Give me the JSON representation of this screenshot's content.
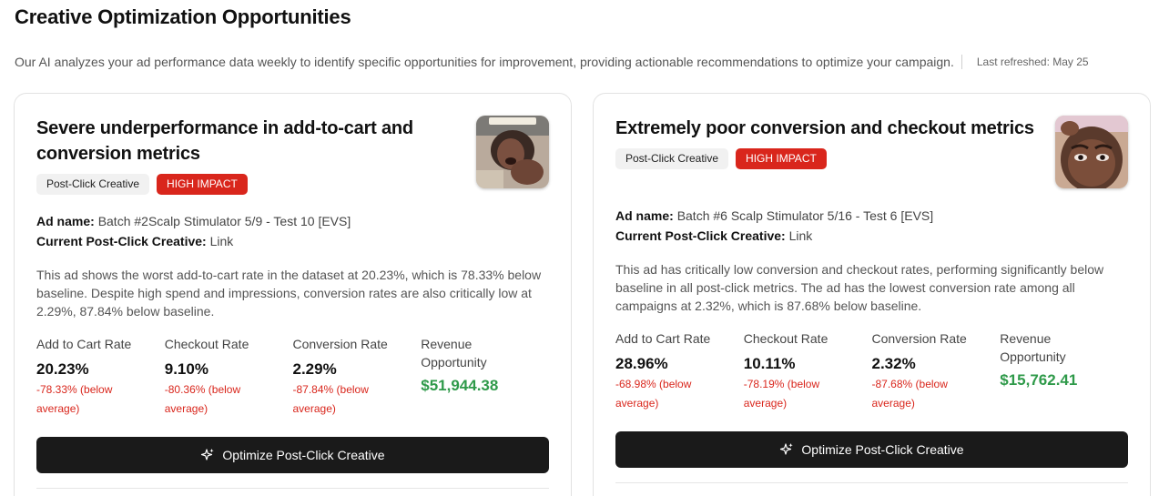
{
  "page": {
    "title": "Creative Optimization Opportunities",
    "subtitle": "Our AI analyzes your ad performance data weekly to identify specific opportunities for improvement, providing actionable recommendations to optimize your campaign.",
    "last_refreshed": "Last refreshed: May 25"
  },
  "colors": {
    "high_impact_badge": "#d9261c",
    "negative_delta": "#d9261c",
    "revenue": "#2f9a4a",
    "button": "#1a1a1a"
  },
  "cards": [
    {
      "title": "Severe underperformance in add-to-cart and conversion metrics",
      "category_badge": "Post-Click Creative",
      "impact_badge": "HIGH IMPACT",
      "ad_name_label": "Ad name:",
      "ad_name": "Batch #2Scalp Stimulator 5/9 - Test 10 [EVS]",
      "creative_label": "Current Post-Click Creative:",
      "creative_value": "Link",
      "description": "This ad shows the worst add-to-cart rate in the dataset at 20.23%, which is 78.33% below baseline. Despite high spend and impressions, conversion rates are also critically low at 2.29%, 87.84% below baseline.",
      "metrics": [
        {
          "label": "Add to Cart Rate",
          "value": "20.23%",
          "delta": "-78.33% (below average)"
        },
        {
          "label": "Checkout Rate",
          "value": "9.10%",
          "delta": "-80.36% (below average)"
        },
        {
          "label": "Conversion Rate",
          "value": "2.29%",
          "delta": "-87.84% (below average)"
        }
      ],
      "revenue_label": "Revenue Opportunity",
      "revenue_value": "$51,944.38",
      "button_label": "Optimize Post-Click Creative",
      "button_icon": "sparkle-icon"
    },
    {
      "title": "Extremely poor conversion and checkout metrics",
      "category_badge": "Post-Click Creative",
      "impact_badge": "HIGH IMPACT",
      "ad_name_label": "Ad name:",
      "ad_name": "Batch #6 Scalp Stimulator 5/16 - Test 6 [EVS]",
      "creative_label": "Current Post-Click Creative:",
      "creative_value": "Link",
      "description": "This ad has critically low conversion and checkout rates, performing significantly below baseline in all post-click metrics. The ad has the lowest conversion rate among all campaigns at 2.32%, which is 87.68% below baseline.",
      "metrics": [
        {
          "label": "Add to Cart Rate",
          "value": "28.96%",
          "delta": "-68.98% (below average)"
        },
        {
          "label": "Checkout Rate",
          "value": "10.11%",
          "delta": "-78.19% (below average)"
        },
        {
          "label": "Conversion Rate",
          "value": "2.32%",
          "delta": "-87.68% (below average)"
        }
      ],
      "revenue_label": "Revenue Opportunity",
      "revenue_value": "$15,762.41",
      "button_label": "Optimize Post-Click Creative",
      "button_icon": "sparkle-icon"
    }
  ]
}
